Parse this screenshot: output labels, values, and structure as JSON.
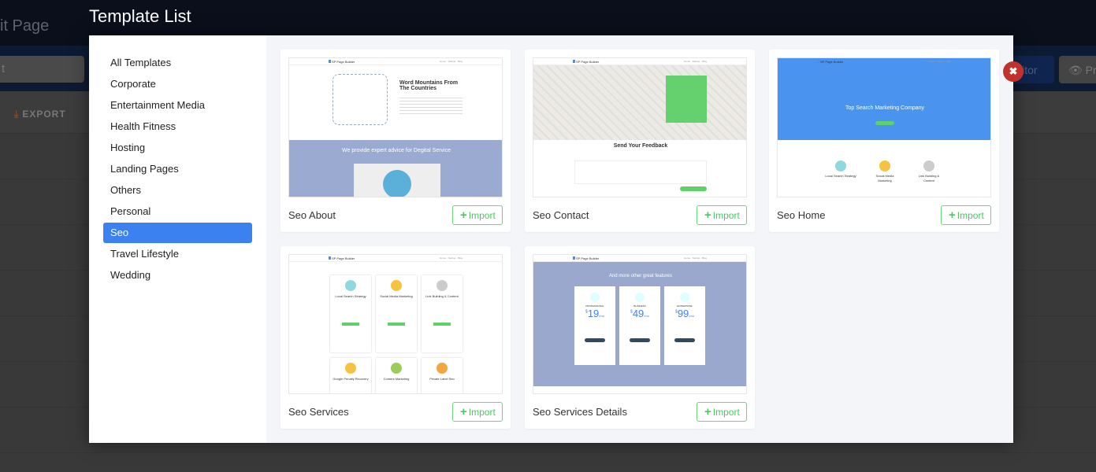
{
  "background": {
    "page_title": "it Page",
    "input_text": "t",
    "editor_button": "Editor",
    "preview_button": "Pre",
    "export_button": "EXPORT"
  },
  "modal": {
    "title": "Template List",
    "close_icon": "close-icon"
  },
  "categories": [
    {
      "label": "All Templates"
    },
    {
      "label": "Corporate"
    },
    {
      "label": "Entertainment Media"
    },
    {
      "label": "Health Fitness"
    },
    {
      "label": "Hosting"
    },
    {
      "label": "Landing Pages"
    },
    {
      "label": "Others"
    },
    {
      "label": "Personal"
    },
    {
      "label": "Seo",
      "active": true
    },
    {
      "label": "Travel Lifestyle"
    },
    {
      "label": "Wedding"
    }
  ],
  "import_label": "Import",
  "colors": {
    "accent": "#3b82f0",
    "import_green": "#4cc764",
    "close_red": "#c0322b"
  },
  "templates": [
    {
      "name": "Seo About",
      "thumb": {
        "heading": "Word Mountains From The Countries",
        "banner": "We provide expert advice for Degital Service"
      }
    },
    {
      "name": "Seo Contact",
      "thumb": {
        "heading": "Send Your Feedback"
      }
    },
    {
      "name": "Seo Home",
      "thumb": {
        "heading": "Top Search Marketing Company",
        "features": [
          "Local Search Strategy",
          "Social Media Marketing",
          "Link Building & Content"
        ]
      }
    },
    {
      "name": "Seo Services",
      "thumb": {
        "features": [
          "Local Search Strategy",
          "Social Media Marketing",
          "Link Building & Content",
          "Google Penalty Recovery",
          "Content Marketing",
          "Private Label Seo"
        ]
      }
    },
    {
      "name": "Seo Services Details",
      "thumb": {
        "heading": "And more other great features",
        "plans": [
          {
            "name": "PROFESSIONAL",
            "price": "19"
          },
          {
            "name": "BUSINESS",
            "price": "49"
          },
          {
            "name": "ENTERPRISE",
            "price": "99"
          }
        ],
        "price_unit": "/mo",
        "currency": "$"
      }
    }
  ],
  "thumb_nav": {
    "logo": "SP Page Builder"
  }
}
